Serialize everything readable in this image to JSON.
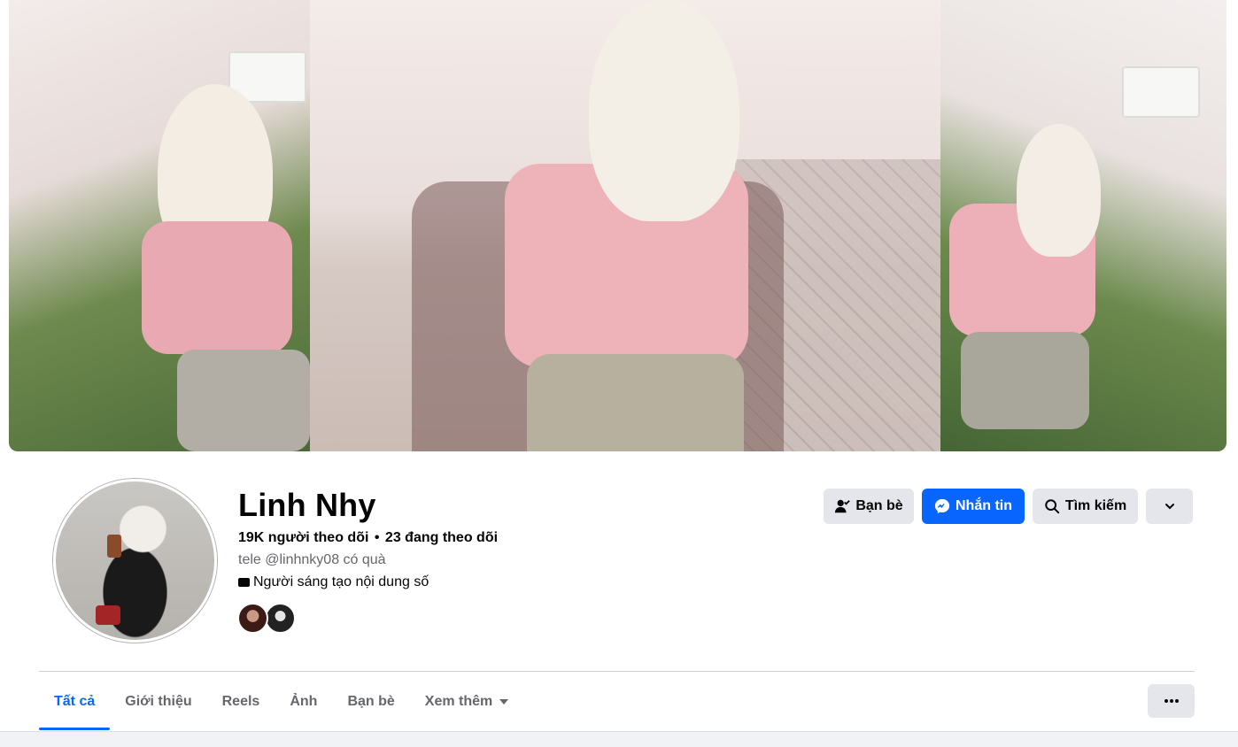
{
  "profile": {
    "name": "Linh Nhy",
    "followers": "19K người theo dõi",
    "separator": "•",
    "following": "23 đang theo dõi",
    "bio": "tele @linhnky08 có quà",
    "category": "Người sáng tạo nội dung số"
  },
  "actions": {
    "friends_label": "Bạn bè",
    "message_label": "Nhắn tin",
    "search_label": "Tìm kiếm"
  },
  "tabs": [
    {
      "label": "Tất cả",
      "active": true
    },
    {
      "label": "Giới thiệu"
    },
    {
      "label": "Reels"
    },
    {
      "label": "Ảnh"
    },
    {
      "label": "Bạn bè"
    },
    {
      "label": "Xem thêm"
    }
  ],
  "colors": {
    "accent": "#0866ff",
    "button_gray": "#e4e6eb",
    "secondary_text": "#65676b"
  },
  "icons": {
    "friends": "person-check-icon",
    "message": "messenger-icon",
    "search": "search-icon",
    "more": "chevron-down-icon",
    "tab_more": "caret-down-icon",
    "options": "ellipsis-icon",
    "category": "creator-icon"
  }
}
